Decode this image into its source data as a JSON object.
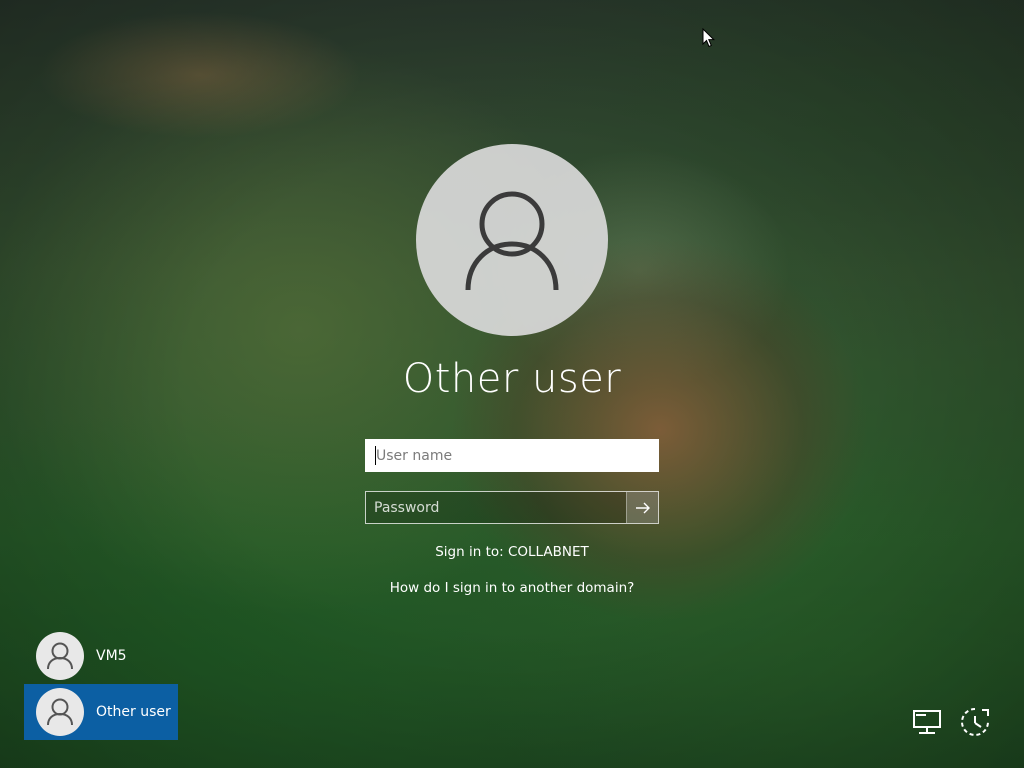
{
  "login": {
    "title": "Other user",
    "username_placeholder": "User name",
    "password_placeholder": "Password",
    "sign_in_to": "Sign in to: COLLABNET",
    "domain_help_link": "How do I sign in to another domain?"
  },
  "user_list": {
    "items": [
      {
        "name": "VM5",
        "selected": false
      },
      {
        "name": "Other user",
        "selected": true
      }
    ]
  },
  "icons": {
    "avatar": "user-avatar-icon",
    "submit": "arrow-right-icon",
    "network": "network-icon",
    "ease_of_access": "ease-of-access-icon",
    "cursor": "mouse-pointer-icon"
  },
  "colors": {
    "selected_user_bg": "#0c5fa3",
    "avatar_bg": "#dadada",
    "text": "#ffffff"
  }
}
